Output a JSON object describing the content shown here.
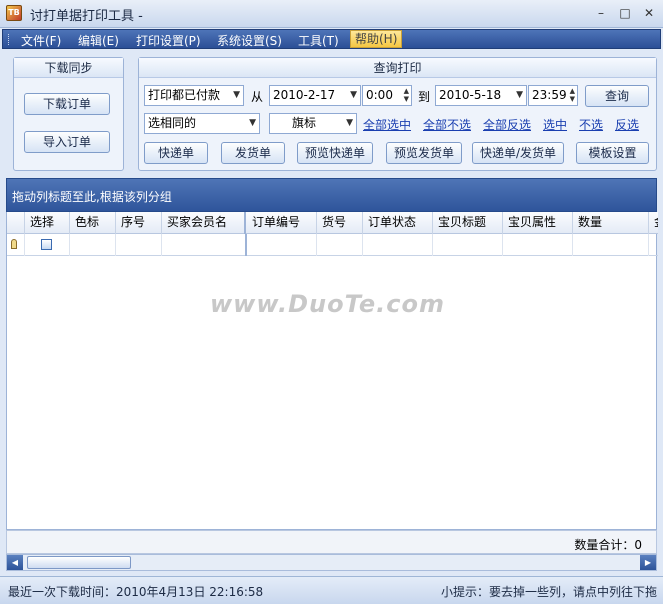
{
  "window": {
    "title": "讨打单据打印工具 -",
    "icon_text": "TB"
  },
  "menu": [
    {
      "label": "文件(F)"
    },
    {
      "label": "编辑(E)"
    },
    {
      "label": "打印设置(P)"
    },
    {
      "label": "系统设置(S)"
    },
    {
      "label": "工具(T)"
    },
    {
      "label": "帮助(H)"
    }
  ],
  "sync_panel": {
    "title": "下载同步",
    "download_button": "下载订单",
    "import_button": "导入订单"
  },
  "query_panel": {
    "title": "查询打印",
    "status_combo": "打印都已付款",
    "from_label": "从",
    "from_date": "2010-2-17",
    "from_time": "0:00",
    "to_label": "到",
    "to_date": "2010-5-18",
    "to_time": "23:59",
    "query_button": "查询",
    "match_combo": "选相同的",
    "flag_combo": "旗标",
    "links": [
      "全部选中",
      "全部不选",
      "全部反选",
      "选中",
      "不选",
      "反选"
    ],
    "buttons": [
      "快递单",
      "发货单",
      "预览快递单",
      "预览发货单",
      "快递单/发货单",
      "模板设置"
    ]
  },
  "group_bar": {
    "text": "拖动列标题至此,根据该列分组"
  },
  "grid": {
    "columns": [
      "选择",
      "色标",
      "序号",
      "买家会员名",
      "订单编号",
      "货号",
      "订单状态",
      "宝贝标题",
      "宝贝属性",
      "数量",
      "金"
    ]
  },
  "watermark": "www.DuoTe.com",
  "footer": {
    "sum_text": "数量合计：0"
  },
  "status": {
    "last_download": "最近一次下载时间：2010年4月13日  22:16:58",
    "tip": "小提示：要去掉一些列，请点中列往下拖"
  },
  "colors": {
    "menubar": "#2b4f96",
    "groupbar": "#3a60a6",
    "link": "#1a3fb0"
  }
}
